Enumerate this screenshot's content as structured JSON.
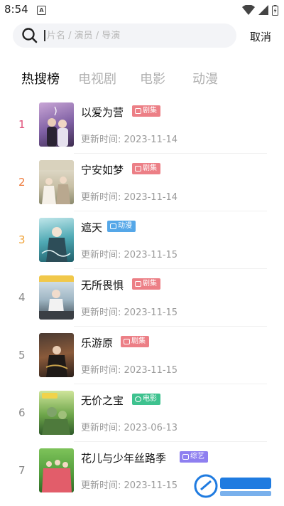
{
  "status": {
    "time": "8:54",
    "app_icon": "A"
  },
  "search": {
    "placeholder": "片名 / 演员 / 导演",
    "value": "",
    "cancel_label": "取消"
  },
  "tabs": [
    {
      "label": "热搜榜",
      "active": true
    },
    {
      "label": "电视剧",
      "active": false
    },
    {
      "label": "电影",
      "active": false
    },
    {
      "label": "动漫",
      "active": false
    }
  ],
  "colors": {
    "rank_pink": "#e0507a",
    "rank_orange": "#ee7a3b",
    "rank_yellow": "#f0a33a",
    "rank_gray": "#8a8a8a",
    "tag_drama": "#ec7f86",
    "tag_anime": "#55a7e8",
    "tag_movie": "#3ec28f",
    "tag_variety": "#8e7ff0"
  },
  "items": [
    {
      "rank": "1",
      "title": "以爱为营",
      "tag": "剧集",
      "tag_icon": "tv-icon",
      "update_label": "更新时间:",
      "date": "2023-11-14"
    },
    {
      "rank": "2",
      "title": "宁安如梦",
      "tag": "剧集",
      "tag_icon": "tv-icon",
      "update_label": "更新时间:",
      "date": "2023-11-14"
    },
    {
      "rank": "3",
      "title": "遮天",
      "tag": "动漫",
      "tag_icon": "anime-icon",
      "update_label": "更新时间:",
      "date": "2023-11-15"
    },
    {
      "rank": "4",
      "title": "无所畏惧",
      "tag": "剧集",
      "tag_icon": "tv-icon",
      "update_label": "更新时间:",
      "date": "2023-11-15"
    },
    {
      "rank": "5",
      "title": "乐游原",
      "tag": "剧集",
      "tag_icon": "tv-icon",
      "update_label": "更新时间:",
      "date": "2023-11-15"
    },
    {
      "rank": "6",
      "title": "无价之宝",
      "tag": "电影",
      "tag_icon": "film-icon",
      "update_label": "更新时间:",
      "date": "2023-06-13"
    },
    {
      "rank": "7",
      "title": "花儿与少年丝路季",
      "tag": "综艺",
      "tag_icon": "variety-icon",
      "update_label": "更新时间:",
      "date": "2023-11-15"
    }
  ]
}
